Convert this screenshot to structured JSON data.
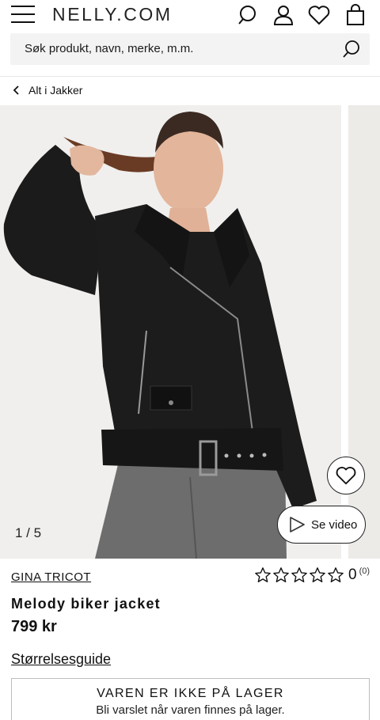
{
  "header": {
    "logo": "NELLY.COM",
    "icons": [
      "menu-icon",
      "search-icon",
      "account-icon",
      "heart-icon",
      "bag-icon"
    ]
  },
  "search": {
    "placeholder": "Søk produkt, navn, merke, m.m."
  },
  "breadcrumb": {
    "label": "Alt i Jakker"
  },
  "gallery": {
    "counter": "1 / 5",
    "video_label": "Se video"
  },
  "product": {
    "brand": "GINA TRICOT",
    "name": "Melody biker jacket",
    "price": "799 kr",
    "rating": {
      "stars_filled": 0,
      "stars_total": 5,
      "score": "0",
      "count": "(0)"
    },
    "size_guide": "Størrelsesguide"
  },
  "stock": {
    "title": "VAREN ER IKKE PÅ LAGER",
    "subtitle": "Bli varslet når varen finnes på lager."
  },
  "colors": {
    "text": "#111111",
    "search_bg": "#f3f3f3",
    "image_bg": "#efefed",
    "jacket": "#1b1b1b",
    "jeans": "#6e6e6e"
  }
}
